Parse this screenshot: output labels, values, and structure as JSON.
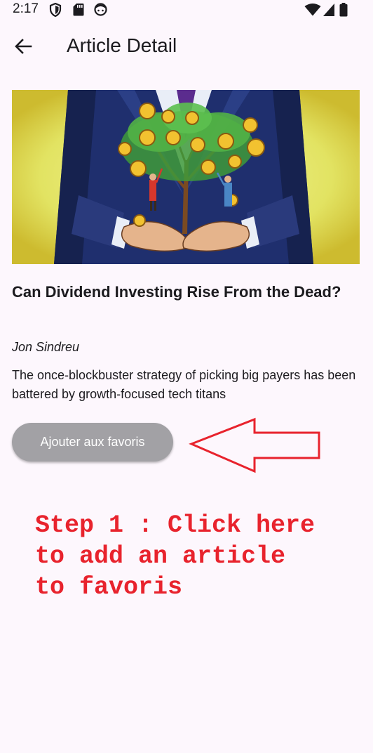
{
  "status_bar": {
    "time": "2:17",
    "left_icons": [
      "shield-icon",
      "sd-card-icon",
      "face-icon"
    ],
    "right_icons": [
      "wifi-icon",
      "signal-icon",
      "battery-icon"
    ]
  },
  "app_bar": {
    "back_icon": "arrow-left-icon",
    "title": "Article Detail"
  },
  "article": {
    "image_description": "illustration",
    "title": "Can Dividend Investing Rise From the Dead?",
    "author": "Jon Sindreu",
    "summary": "The once-blockbuster strategy of picking big payers has been battered by growth-focused tech titans",
    "favorite_button_label": "Ajouter aux favoris"
  },
  "annotation": {
    "text": "Step 1 : Click here\nto add an article\nto favoris",
    "color": "#e8232d"
  },
  "colors": {
    "background": "#fdf7fd",
    "button_background": "#a2a1a5",
    "button_text": "#ffffff",
    "annotation_red": "#e8232d"
  }
}
